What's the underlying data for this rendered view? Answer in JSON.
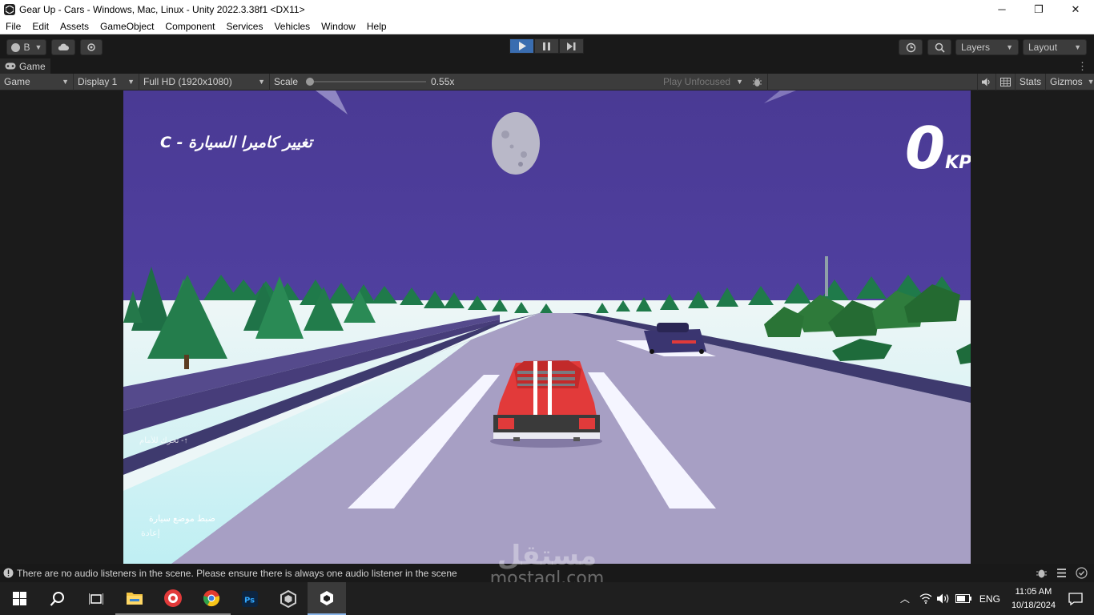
{
  "window": {
    "title": "Gear Up - Cars - Windows, Mac, Linux - Unity 2022.3.38f1 <DX11>",
    "controls": [
      "─",
      "❐",
      "✕"
    ]
  },
  "menu": [
    "File",
    "Edit",
    "Assets",
    "GameObject",
    "Component",
    "Services",
    "Vehicles",
    "Window",
    "Help"
  ],
  "toolbar": {
    "account_label": "B",
    "layers_label": "Layers",
    "layout_label": "Layout"
  },
  "tab": {
    "label": "Game"
  },
  "game_bar": {
    "view_select": "Game",
    "display_select": "Display 1",
    "resolution_select": "Full HD (1920x1080)",
    "scale_label": "Scale",
    "scale_value": "0.55x",
    "scale_level": 0.0,
    "play_mode": "Play Unfocused",
    "stats_label": "Stats",
    "gizmos_label": "Gizmos"
  },
  "game_hud": {
    "camera_hint": "تغيير كاميرا السيارة - C",
    "speed_value": "0",
    "speed_unit": "KPH",
    "controls_hint_1": "↑- تحرك للأمام",
    "controls_hint_2": "ضبط موضع سيارة",
    "controls_hint_3": "إعادة"
  },
  "status": {
    "message": "There are no audio listeners in the scene. Please ensure there is always one audio listener in the scene"
  },
  "watermark": {
    "arabic": "مستقل",
    "latin": "mostaql.com"
  },
  "taskbar": {
    "language": "ENG",
    "time": "11:05 AM",
    "date": "10/18/2024"
  },
  "colors": {
    "sky": "#4a3a94",
    "road": "#a79fc4",
    "snow": "#e9f4f4",
    "car": "#e23a3a",
    "editor_bg": "#191919",
    "play_active": "#3a6db0"
  }
}
